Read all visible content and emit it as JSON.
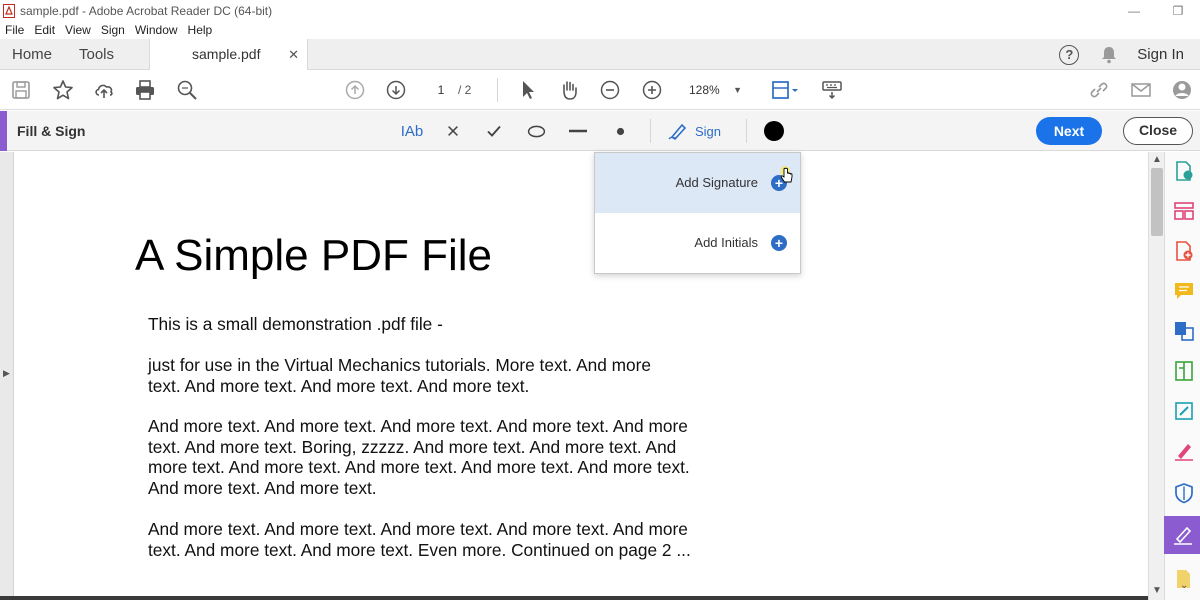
{
  "window": {
    "title": "sample.pdf - Adobe Acrobat Reader DC (64-bit)",
    "controls": [
      "—",
      "❐"
    ]
  },
  "menu": [
    "File",
    "Edit",
    "View",
    "Sign",
    "Window",
    "Help"
  ],
  "tabs": {
    "home": "Home",
    "tools": "Tools",
    "document": "sample.pdf",
    "close_glyph": "✕",
    "sign_in": "Sign In"
  },
  "toolbar": {
    "page_current": "1",
    "page_total": "/ 2",
    "zoom": "128%",
    "zoom_caret": "▼"
  },
  "fill_sign": {
    "title": "Fill & Sign",
    "text_tool": "IAb",
    "sign_label": "Sign",
    "next": "Next",
    "close": "Close",
    "accent_color": "#8b5ccf",
    "primary_color": "#1a73e8"
  },
  "sign_menu": {
    "items": [
      {
        "label": "Add Signature",
        "icon": "plus-circle-icon"
      },
      {
        "label": "Add Initials",
        "icon": "plus-circle-icon"
      }
    ]
  },
  "document": {
    "title": "A Simple PDF File",
    "paragraphs": [
      "This is a small demonstration .pdf file -",
      "just for use in the Virtual Mechanics tutorials. More text. And more\ntext. And more text. And more text. And more text.",
      "And more text. And more text. And more text. And more text. And more\ntext. And more text. Boring, zzzzz. And more text. And more text. And\nmore text. And more text. And more text. And more text. And more text.\nAnd more text. And more text.",
      "And more text. And more text. And more text. And more text. And more\ntext. And more text. And more text. Even more. Continued on page 2 ..."
    ]
  }
}
